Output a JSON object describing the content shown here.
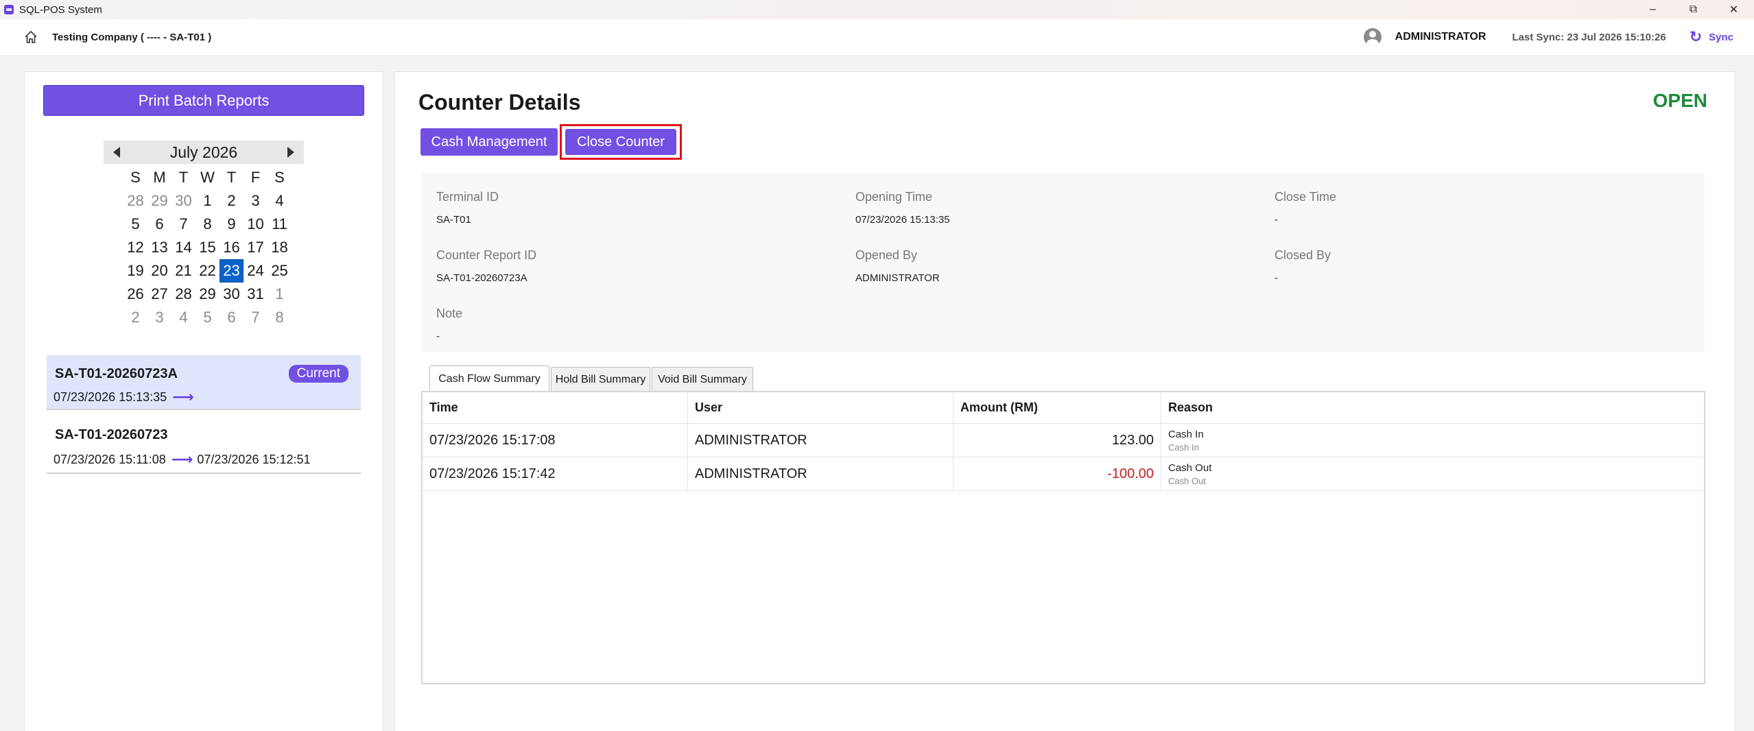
{
  "window": {
    "title": "SQL-POS System"
  },
  "header": {
    "company": "Testing Company ( ---- - SA-T01 )",
    "user": "ADMINISTRATOR",
    "last_sync": "Last Sync: 23 Jul 2026 15:10:26",
    "sync_label": "Sync"
  },
  "sidebar": {
    "print_button": "Print Batch Reports",
    "calendar": {
      "month_label": "July 2026",
      "weekdays": [
        "S",
        "M",
        "T",
        "W",
        "T",
        "F",
        "S"
      ],
      "weeks": [
        [
          "28",
          "29",
          "30",
          "1",
          "2",
          "3",
          "4"
        ],
        [
          "5",
          "6",
          "7",
          "8",
          "9",
          "10",
          "11"
        ],
        [
          "12",
          "13",
          "14",
          "15",
          "16",
          "17",
          "18"
        ],
        [
          "19",
          "20",
          "21",
          "22",
          "23",
          "24",
          "25"
        ],
        [
          "26",
          "27",
          "28",
          "29",
          "30",
          "31",
          "1"
        ],
        [
          "2",
          "3",
          "4",
          "5",
          "6",
          "7",
          "8"
        ]
      ],
      "selected_day": "23"
    },
    "batches": [
      {
        "id": "SA-T01-20260723A",
        "start": "07/23/2026 15:13:35",
        "end": "",
        "badge": "Current"
      },
      {
        "id": "SA-T01-20260723",
        "start": "07/23/2026 15:11:08",
        "end": "07/23/2026 15:12:51",
        "badge": ""
      }
    ]
  },
  "main": {
    "title": "Counter Details",
    "status": "OPEN",
    "status_color": "#1c8a3d",
    "buttons": {
      "cash_management": "Cash Management",
      "close_counter": "Close Counter"
    },
    "info": {
      "terminal_id_label": "Terminal ID",
      "terminal_id": "SA-T01",
      "opening_time_label": "Opening Time",
      "opening_time": "07/23/2026 15:13:35",
      "close_time_label": "Close Time",
      "close_time": "-",
      "counter_report_id_label": "Counter Report ID",
      "counter_report_id": "SA-T01-20260723A",
      "opened_by_label": "Opened By",
      "opened_by": "ADMINISTRATOR",
      "closed_by_label": "Closed By",
      "closed_by": "-",
      "note_label": "Note",
      "note": "-"
    },
    "tabs": [
      "Cash Flow Summary",
      "Hold Bill Summary",
      "Void Bill Summary"
    ],
    "table": {
      "headers": [
        "Time",
        "User",
        "Amount (RM)",
        "Reason"
      ],
      "rows": [
        {
          "time": "07/23/2026 15:17:08",
          "user": "ADMINISTRATOR",
          "amount": "123.00",
          "reason": "Cash In",
          "reason_sub": "Cash In"
        },
        {
          "time": "07/23/2026 15:17:42",
          "user": "ADMINISTRATOR",
          "amount": "-100.00",
          "reason": "Cash Out",
          "reason_sub": "Cash Out"
        }
      ]
    }
  }
}
